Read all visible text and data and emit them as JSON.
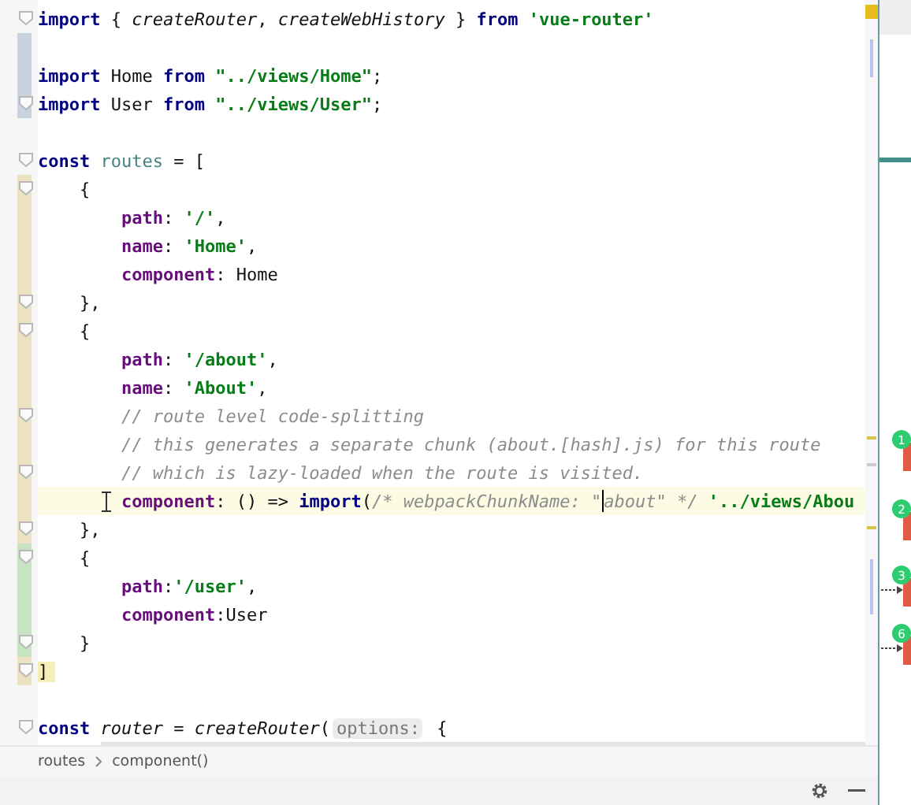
{
  "editor": {
    "lines": [
      {
        "fold": true,
        "tokens": [
          {
            "text": "import",
            "kind": "kw"
          },
          {
            "text": " { ",
            "kind": "plain"
          },
          {
            "text": "createRouter",
            "kind": "fn"
          },
          {
            "text": ", ",
            "kind": "plain"
          },
          {
            "text": "createWebHistory",
            "kind": "fn"
          },
          {
            "text": " } ",
            "kind": "plain"
          },
          {
            "text": "from ",
            "kind": "kw"
          },
          {
            "text": "'vue-router'",
            "kind": "str"
          }
        ]
      },
      {
        "fold": false,
        "gutter_marker": {
          "color": "#c9d3e0"
        }
      },
      {
        "fold": false,
        "gutter_marker": {
          "color": "#c9d3e0"
        },
        "tokens": [
          {
            "text": "import",
            "kind": "kw"
          },
          {
            "text": " Home ",
            "kind": "plain"
          },
          {
            "text": "from ",
            "kind": "kw"
          },
          {
            "text": "\"../views/Home\"",
            "kind": "str"
          },
          {
            "text": ";",
            "kind": "plain"
          }
        ]
      },
      {
        "fold": true,
        "gutter_marker": {
          "color": "#c9d3e0"
        },
        "tokens": [
          {
            "text": "import",
            "kind": "kw"
          },
          {
            "text": " User ",
            "kind": "plain"
          },
          {
            "text": "from ",
            "kind": "kw"
          },
          {
            "text": "\"../views/User\"",
            "kind": "str"
          },
          {
            "text": ";",
            "kind": "plain"
          }
        ]
      },
      {
        "fold": false
      },
      {
        "fold": true,
        "tokens": [
          {
            "text": "const ",
            "kind": "kw"
          },
          {
            "text": "routes",
            "kind": "var"
          },
          {
            "text": " = [",
            "kind": "plain"
          }
        ]
      },
      {
        "fold": true,
        "gutter_marker": {
          "color": "#ece2c2"
        },
        "tokens": [
          {
            "text": "    {",
            "kind": "plain"
          }
        ]
      },
      {
        "fold": false,
        "gutter_marker": {
          "color": "#ece2c2"
        },
        "tokens": [
          {
            "text": "        path",
            "kind": "prop"
          },
          {
            "text": ": ",
            "kind": "plain"
          },
          {
            "text": "'/'",
            "kind": "str"
          },
          {
            "text": ",",
            "kind": "plain"
          }
        ]
      },
      {
        "fold": false,
        "gutter_marker": {
          "color": "#ece2c2"
        },
        "tokens": [
          {
            "text": "        name",
            "kind": "prop"
          },
          {
            "text": ": ",
            "kind": "plain"
          },
          {
            "text": "'Home'",
            "kind": "str"
          },
          {
            "text": ",",
            "kind": "plain"
          }
        ]
      },
      {
        "fold": false,
        "gutter_marker": {
          "color": "#ece2c2"
        },
        "tokens": [
          {
            "text": "        component",
            "kind": "prop"
          },
          {
            "text": ": Home",
            "kind": "plain"
          }
        ]
      },
      {
        "fold": true,
        "gutter_marker": {
          "color": "#ece2c2"
        },
        "tokens": [
          {
            "text": "    },",
            "kind": "plain"
          }
        ]
      },
      {
        "fold": true,
        "gutter_marker": {
          "color": "#ece2c2"
        },
        "tokens": [
          {
            "text": "    {",
            "kind": "plain"
          }
        ]
      },
      {
        "fold": false,
        "gutter_marker": {
          "color": "#ece2c2"
        },
        "tokens": [
          {
            "text": "        path",
            "kind": "prop"
          },
          {
            "text": ": ",
            "kind": "plain"
          },
          {
            "text": "'/about'",
            "kind": "str"
          },
          {
            "text": ",",
            "kind": "plain"
          }
        ]
      },
      {
        "fold": false,
        "gutter_marker": {
          "color": "#ece2c2"
        },
        "tokens": [
          {
            "text": "        name",
            "kind": "prop"
          },
          {
            "text": ": ",
            "kind": "plain"
          },
          {
            "text": "'About'",
            "kind": "str"
          },
          {
            "text": ",",
            "kind": "plain"
          }
        ]
      },
      {
        "fold": true,
        "gutter_marker": {
          "color": "#ece2c2"
        },
        "tokens": [
          {
            "text": "        // route level code-splitting",
            "kind": "com"
          }
        ]
      },
      {
        "fold": false,
        "gutter_marker": {
          "color": "#ece2c2"
        },
        "tokens": [
          {
            "text": "        // this generates a separate chunk (about.[hash].js) for this route",
            "kind": "com"
          }
        ]
      },
      {
        "fold": true,
        "gutter_marker": {
          "color": "#ece2c2"
        },
        "tokens": [
          {
            "text": "        // which is lazy-loaded when the route is visited.",
            "kind": "com"
          }
        ]
      },
      {
        "fold": false,
        "gutter_marker": {
          "color": "#ece2c2"
        },
        "current": true,
        "mouse_pointer": true,
        "tokens": [
          {
            "text": "        component",
            "kind": "prop"
          },
          {
            "text": ": () => ",
            "kind": "plain"
          },
          {
            "text": "import",
            "kind": "kw"
          },
          {
            "text": "(",
            "kind": "plain"
          },
          {
            "text": "/* webpackChunkName: \"",
            "kind": "com"
          },
          {
            "text": "about\" */ ",
            "kind": "com",
            "caret": true
          },
          {
            "text": "'../views/Abou",
            "kind": "str"
          }
        ]
      },
      {
        "fold": true,
        "gutter_marker": {
          "color": "#ece2c2"
        },
        "tokens": [
          {
            "text": "    },",
            "kind": "plain"
          }
        ]
      },
      {
        "fold": true,
        "gutter_marker": {
          "color": "#c8e2c4"
        },
        "tokens": [
          {
            "text": "    {",
            "kind": "plain"
          }
        ]
      },
      {
        "fold": false,
        "gutter_marker": {
          "color": "#c8e2c4"
        },
        "tokens": [
          {
            "text": "        path",
            "kind": "prop"
          },
          {
            "text": ":",
            "kind": "plain"
          },
          {
            "text": "'/user'",
            "kind": "str"
          },
          {
            "text": ",",
            "kind": "plain"
          }
        ]
      },
      {
        "fold": false,
        "gutter_marker": {
          "color": "#c8e2c4"
        },
        "tokens": [
          {
            "text": "        component",
            "kind": "prop"
          },
          {
            "text": ":User",
            "kind": "plain"
          }
        ]
      },
      {
        "fold": true,
        "gutter_marker": {
          "color": "#c8e2c4"
        },
        "tokens": [
          {
            "text": "    }",
            "kind": "plain"
          }
        ]
      },
      {
        "fold": true,
        "gutter_marker": {
          "color": "#ece2c2"
        },
        "bracket_match": true,
        "tokens": [
          {
            "text": "]",
            "kind": "plain"
          }
        ]
      },
      {
        "fold": false
      },
      {
        "fold": true,
        "tokens": [
          {
            "text": "const ",
            "kind": "kw"
          },
          {
            "text": "router",
            "kind": "fn"
          },
          {
            "text": " = ",
            "kind": "plain"
          },
          {
            "text": "createRouter",
            "kind": "fn"
          },
          {
            "text": "(",
            "kind": "plain"
          },
          {
            "text": "options:",
            "kind": "hint"
          },
          {
            "text": " {",
            "kind": "plain"
          }
        ]
      }
    ]
  },
  "breadcrumb": [
    "routes",
    "component()"
  ],
  "diagram": {
    "nodes": [
      {
        "badge": "1",
        "incoming": false
      },
      {
        "badge": "2",
        "incoming": false
      },
      {
        "badge": "3",
        "incoming": true
      },
      {
        "badge": "6",
        "incoming": true
      }
    ]
  }
}
